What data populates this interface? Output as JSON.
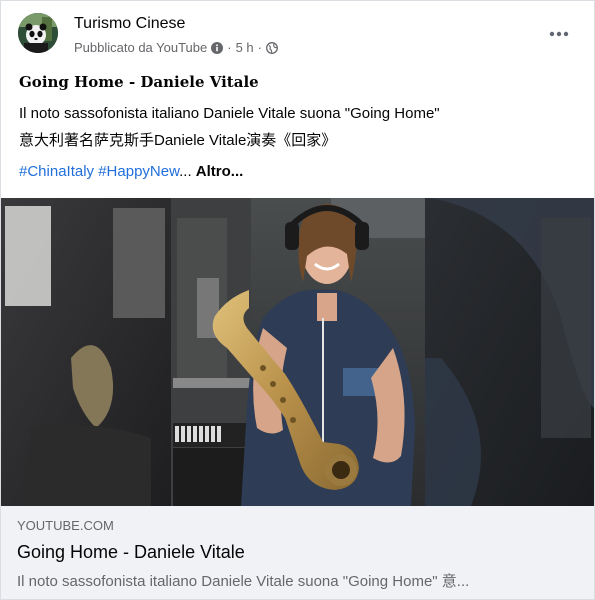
{
  "author": {
    "name": "Turismo Cinese",
    "meta_prefix": "Pubblicato da YouTube",
    "separator": "·",
    "time": "5 h",
    "separator2": "·"
  },
  "post": {
    "title": "Going Home - Daniele Vitale",
    "description_line1": "Il noto sassofonista italiano Daniele Vitale suona \"Going Home\"",
    "description_line2": "意大利著名萨克斯手Daniele Vitale演奏《回家》",
    "hashtags": [
      "#ChinaItaly",
      "#HappyNew"
    ],
    "ellipsis": "...",
    "more_label": "Altro..."
  },
  "preview": {
    "domain": "YOUTUBE.COM",
    "title": "Going Home - Daniele Vitale",
    "description": "Il noto sassofonista italiano Daniele Vitale suona \"Going Home\" 意..."
  },
  "icons": {
    "info": "info-icon",
    "globe": "globe-icon",
    "more": "more-options-icon"
  },
  "colors": {
    "link": "#216fdb",
    "secondary_text": "#65676b",
    "preview_bg": "#f0f2f5"
  }
}
